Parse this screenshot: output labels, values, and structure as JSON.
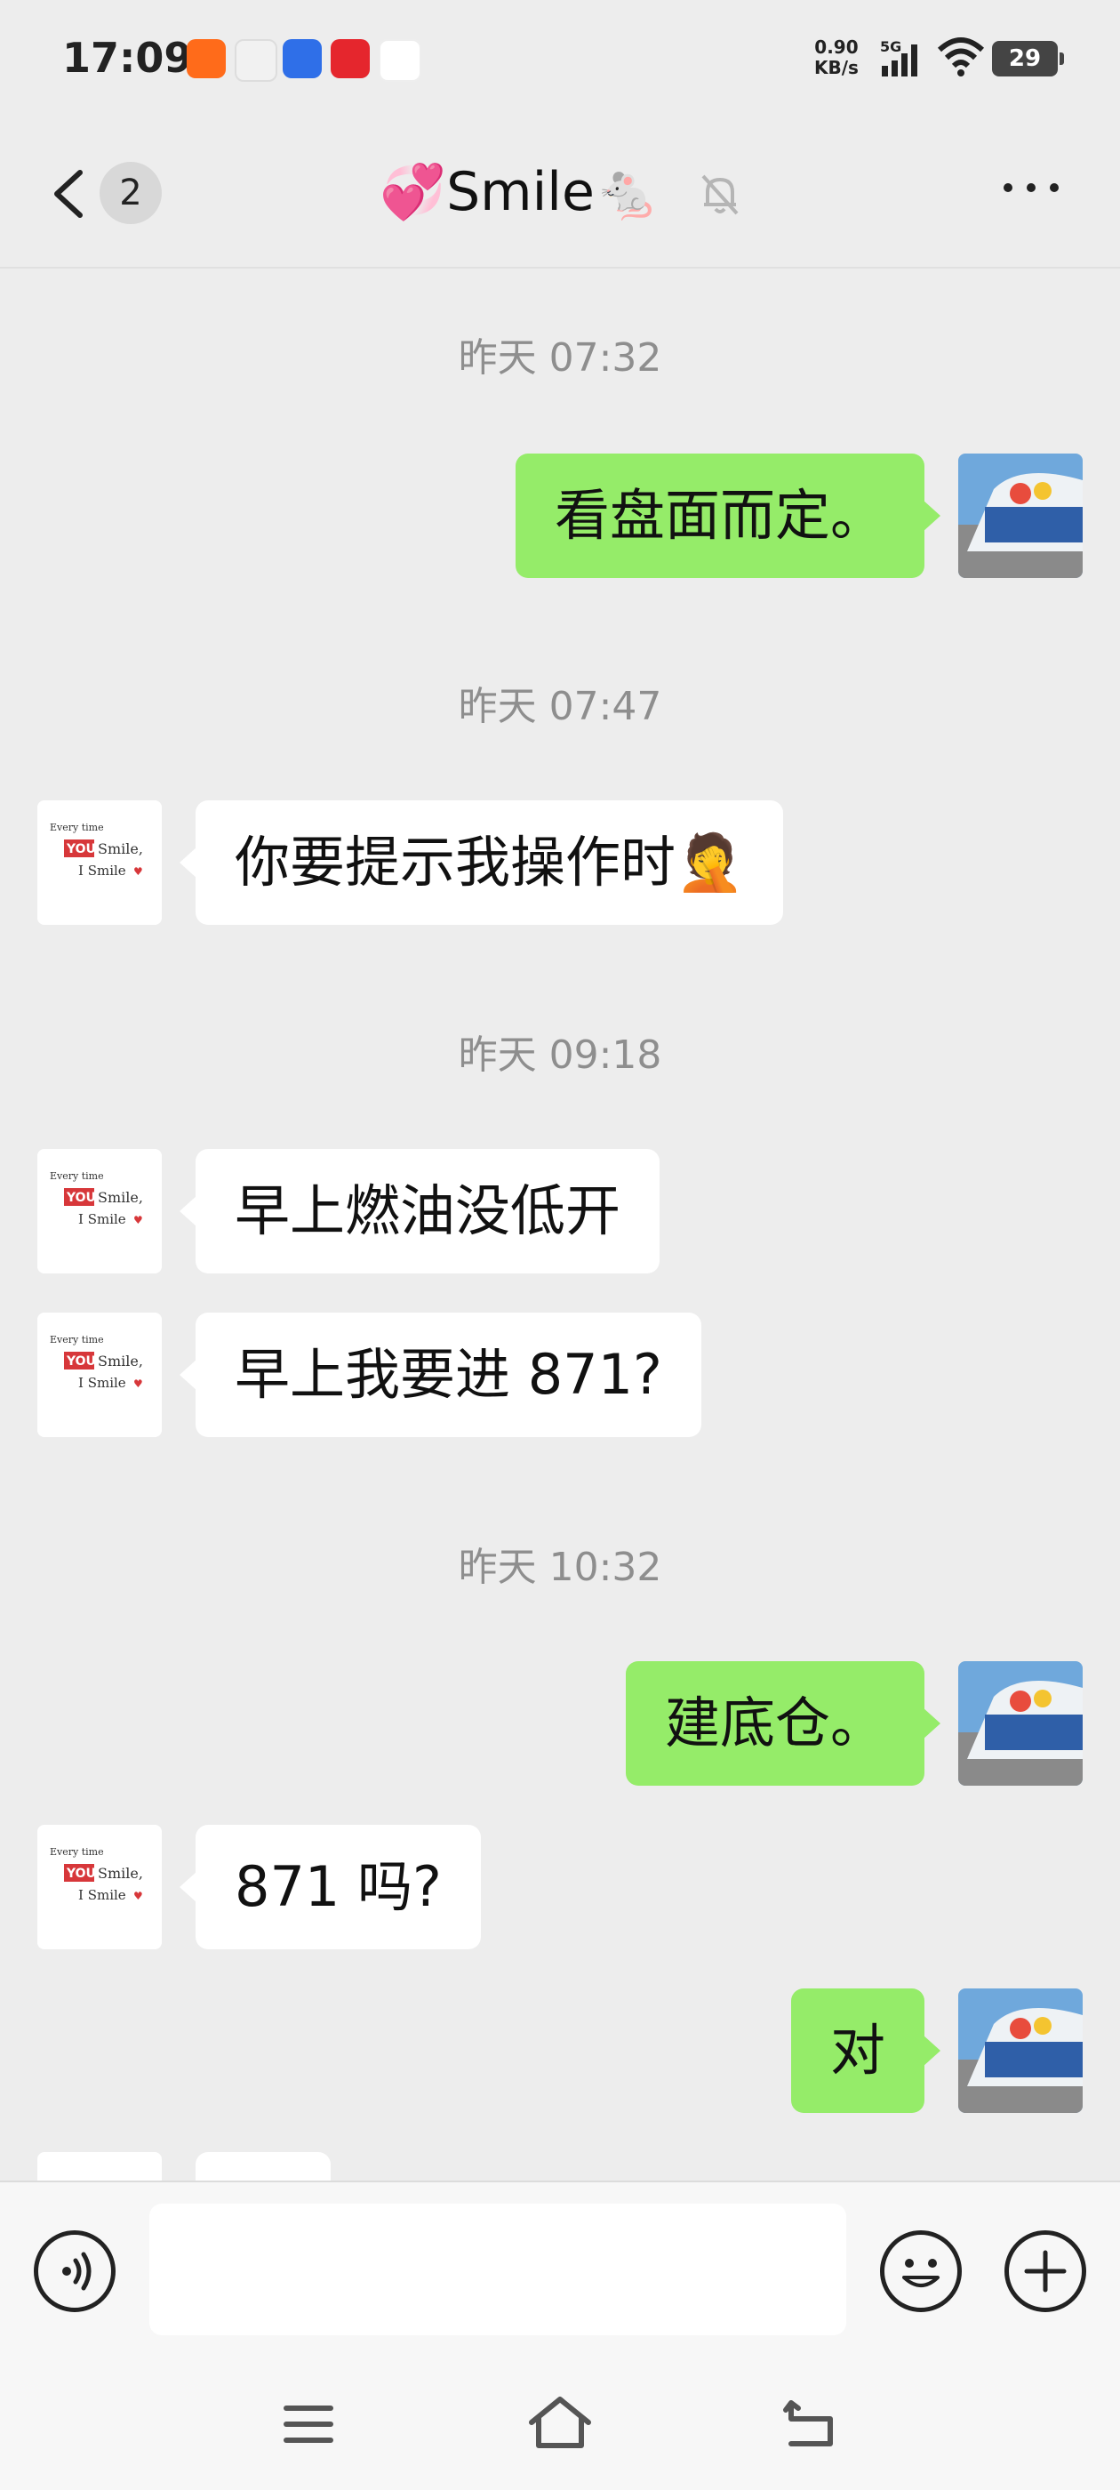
{
  "status_bar": {
    "time": "17:09",
    "net_speed_value": "0.90",
    "net_speed_unit": "KB/s",
    "network_type": "5G",
    "battery": "29",
    "notification_icons": [
      "app-icon-orange",
      "app-icon-maps",
      "app-icon-baidu",
      "app-icon-red",
      "app-icon-finance"
    ]
  },
  "header": {
    "unread_count": "2",
    "title": "💞Smile🐁"
  },
  "messages": [
    {
      "type": "time",
      "text": "昨天 07:32"
    },
    {
      "type": "self",
      "text": "看盘面而定。"
    },
    {
      "type": "time",
      "text": "昨天 07:47"
    },
    {
      "type": "other",
      "text": "你要提示我操作时🤦"
    },
    {
      "type": "time",
      "text": "昨天 09:18"
    },
    {
      "type": "other",
      "text": "早上燃油没低开"
    },
    {
      "type": "other",
      "text": "早上我要进 871?"
    },
    {
      "type": "time",
      "text": "昨天 10:32"
    },
    {
      "type": "self",
      "text": "建底仓。"
    },
    {
      "type": "other",
      "text": "871 吗?"
    },
    {
      "type": "self",
      "text": "对"
    }
  ],
  "avatar_other": {
    "line1": "Every time",
    "line2": "YOU",
    "line3": "Smile,",
    "line4": "I Smile"
  },
  "input_bar": {
    "draft": ""
  },
  "colors": {
    "self_bubble": "#95ec69",
    "other_bubble": "#ffffff",
    "background": "#ededed"
  }
}
